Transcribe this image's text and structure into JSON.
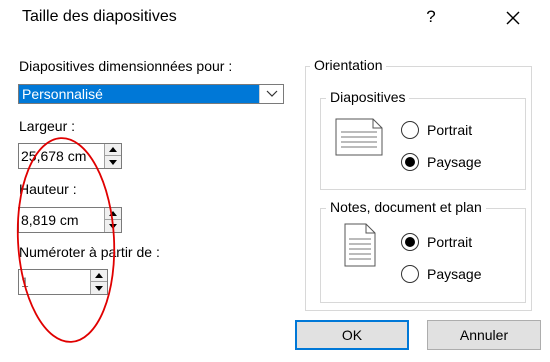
{
  "dialog": {
    "title": "Taille des diapositives",
    "help_label": "?"
  },
  "sizing": {
    "label": "Diapositives dimensionnées pour :",
    "selected": "Personnalisé",
    "width_label": "Largeur :",
    "width_value": "25,678 cm",
    "height_label": "Hauteur :",
    "height_value": "8,819 cm",
    "number_label": "Numéroter à partir de :",
    "number_value": "1"
  },
  "orientation": {
    "label": "Orientation",
    "slides": {
      "label": "Diapositives",
      "portrait": "Portrait",
      "landscape": "Paysage",
      "selected": "landscape"
    },
    "notes": {
      "label": "Notes, document et plan",
      "portrait": "Portrait",
      "landscape": "Paysage",
      "selected": "portrait"
    }
  },
  "buttons": {
    "ok": "OK",
    "cancel": "Annuler"
  },
  "colors": {
    "selection": "#0078d7",
    "annotation": "#e00000"
  }
}
